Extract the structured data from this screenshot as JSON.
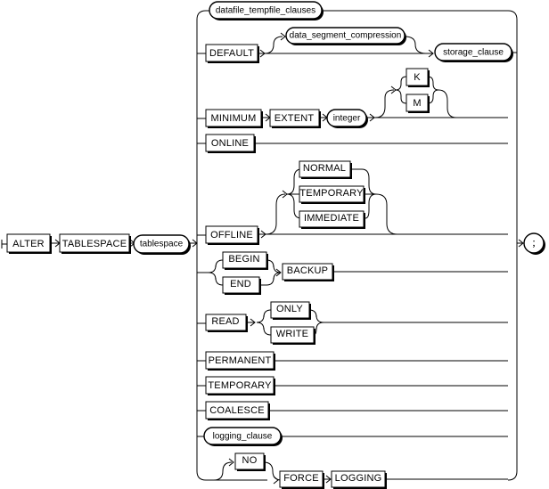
{
  "diagram": {
    "kind": "railroad-syntax-diagram",
    "title": "alter_tablespace",
    "statement": "ALTER TABLESPACE",
    "colors": {
      "line": "#000000",
      "box_fill": "#ffffff",
      "background": "#ffffff",
      "shadow": "#000000"
    },
    "start_sequence": [
      {
        "id": "alter",
        "label": "ALTER",
        "shape": "terminal"
      },
      {
        "id": "tablespace_kw",
        "label": "TABLESPACE",
        "shape": "terminal"
      },
      {
        "id": "tablespace_name",
        "label": "tablespace",
        "shape": "nonterminal"
      }
    ],
    "end_symbol": {
      "id": "semicolon",
      "label": ";",
      "shape": "terminal-round"
    },
    "alternatives": [
      {
        "id": "datafile-tempfile-clauses",
        "row": 1,
        "items": [
          {
            "label": "datafile_tempfile_clauses",
            "shape": "nonterminal"
          }
        ]
      },
      {
        "id": "default-storage",
        "row": 2,
        "items": [
          {
            "label": "DEFAULT",
            "shape": "terminal"
          },
          {
            "label": "data_segment_compression",
            "shape": "nonterminal",
            "optional": true
          },
          {
            "label": "storage_clause",
            "shape": "nonterminal"
          }
        ]
      },
      {
        "id": "minimum-extent",
        "row": 3,
        "items": [
          {
            "label": "MINIMUM",
            "shape": "terminal"
          },
          {
            "label": "EXTENT",
            "shape": "terminal"
          },
          {
            "label": "integer",
            "shape": "nonterminal"
          }
        ],
        "optional_choice": [
          {
            "label": "K",
            "shape": "terminal"
          },
          {
            "label": "M",
            "shape": "terminal"
          }
        ]
      },
      {
        "id": "online",
        "row": 4,
        "items": [
          {
            "label": "ONLINE",
            "shape": "terminal"
          }
        ]
      },
      {
        "id": "offline",
        "row": 5,
        "items": [
          {
            "label": "OFFLINE",
            "shape": "terminal"
          }
        ],
        "optional_choice": [
          {
            "label": "NORMAL",
            "shape": "terminal"
          },
          {
            "label": "TEMPORARY",
            "shape": "terminal"
          },
          {
            "label": "IMMEDIATE",
            "shape": "terminal"
          }
        ]
      },
      {
        "id": "begin-end-backup",
        "row": 6,
        "choice": [
          {
            "label": "BEGIN",
            "shape": "terminal"
          },
          {
            "label": "END",
            "shape": "terminal"
          }
        ],
        "items": [
          {
            "label": "BACKUP",
            "shape": "terminal"
          }
        ]
      },
      {
        "id": "read-only-write",
        "row": 7,
        "items": [
          {
            "label": "READ",
            "shape": "terminal"
          }
        ],
        "choice": [
          {
            "label": "ONLY",
            "shape": "terminal"
          },
          {
            "label": "WRITE",
            "shape": "terminal"
          }
        ]
      },
      {
        "id": "permanent",
        "row": 8,
        "items": [
          {
            "label": "PERMANENT",
            "shape": "terminal"
          }
        ]
      },
      {
        "id": "temporary",
        "row": 9,
        "items": [
          {
            "label": "TEMPORARY",
            "shape": "terminal"
          }
        ]
      },
      {
        "id": "coalesce",
        "row": 10,
        "items": [
          {
            "label": "COALESCE",
            "shape": "terminal"
          }
        ]
      },
      {
        "id": "logging-clause",
        "row": 11,
        "items": [
          {
            "label": "logging_clause",
            "shape": "nonterminal"
          }
        ]
      },
      {
        "id": "force-logging",
        "row": 12,
        "items": [
          {
            "label": "NO",
            "shape": "terminal",
            "optional": true
          },
          {
            "label": "FORCE",
            "shape": "terminal"
          },
          {
            "label": "LOGGING",
            "shape": "terminal"
          }
        ]
      }
    ],
    "labels": {
      "alter": "ALTER",
      "tablespace_kw": "TABLESPACE",
      "tablespace_name": "tablespace",
      "datafile_tempfile_clauses": "datafile_tempfile_clauses",
      "default": "DEFAULT",
      "data_segment_compression": "data_segment_compression",
      "storage_clause": "storage_clause",
      "minimum": "MINIMUM",
      "extent": "EXTENT",
      "integer": "integer",
      "k": "K",
      "m": "M",
      "online": "ONLINE",
      "offline": "OFFLINE",
      "normal": "NORMAL",
      "temporary_off": "TEMPORARY",
      "immediate": "IMMEDIATE",
      "begin": "BEGIN",
      "end": "END",
      "backup": "BACKUP",
      "read": "READ",
      "only": "ONLY",
      "write": "WRITE",
      "permanent": "PERMANENT",
      "temporary": "TEMPORARY",
      "coalesce": "COALESCE",
      "logging_clause": "logging_clause",
      "no": "NO",
      "force": "FORCE",
      "logging": "LOGGING",
      "semicolon": ";"
    }
  }
}
